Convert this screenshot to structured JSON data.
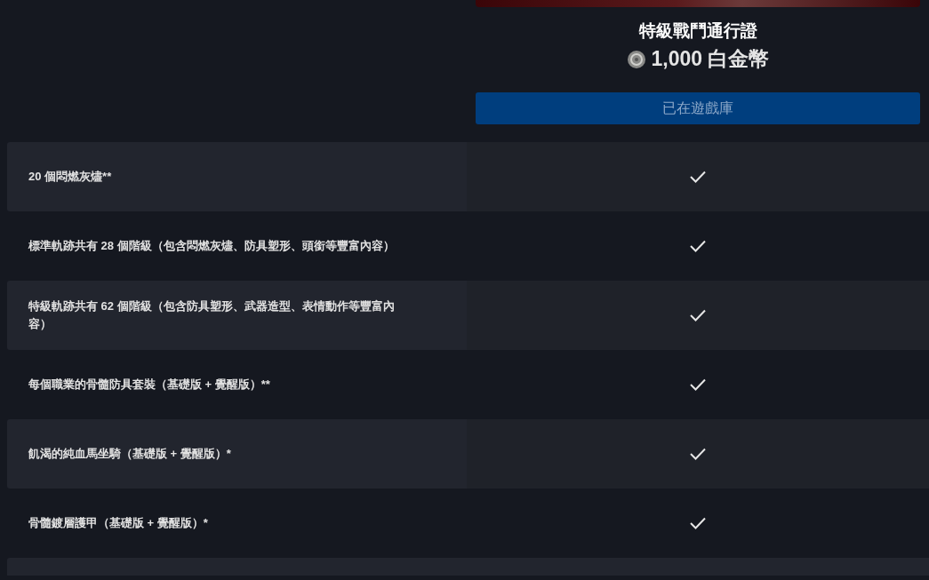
{
  "pass": {
    "title": "特級戰鬥通行證",
    "price": "1,000 白金幣",
    "button": "已在遊戲庫"
  },
  "rows": [
    {
      "label": "20 個悶燃灰燼**",
      "included": true
    },
    {
      "label": "標準軌跡共有 28 個階級（包含悶燃灰燼、防具塑形、頭銜等豐富內容）",
      "included": true
    },
    {
      "label": "特級軌跡共有 62 個階級（包含防具塑形、武器造型、表情動作等豐富內容）",
      "included": true
    },
    {
      "label": "每個職業的骨髓防具套裝（基礎版 + 覺醒版）**",
      "included": true
    },
    {
      "label": "飢渴的純血馬坐騎（基礎版 + 覺醒版）*",
      "included": true
    },
    {
      "label": "骨髓鍍層護甲（基礎版 + 覺醒版）*",
      "included": true
    }
  ]
}
